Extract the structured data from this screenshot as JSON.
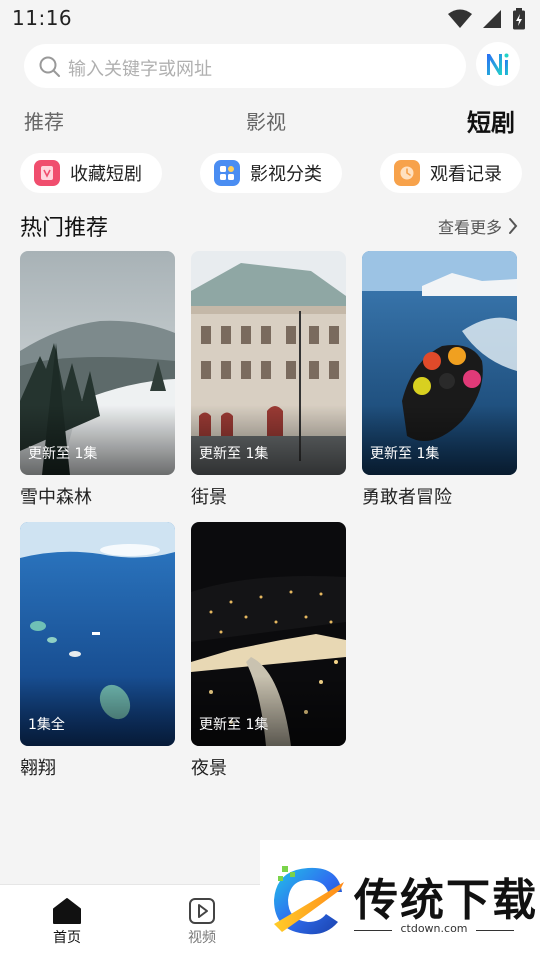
{
  "status_bar": {
    "time": "11:16"
  },
  "search": {
    "placeholder": "输入关键字或网址",
    "ai_icon": "ai-assistant-icon"
  },
  "top_tabs": [
    {
      "label": "推荐"
    },
    {
      "label": "影视"
    },
    {
      "label": "短剧",
      "active": true
    }
  ],
  "chips": [
    {
      "label": "收藏短剧",
      "icon": "favorites-icon",
      "color": "#f04e6e"
    },
    {
      "label": "影视分类",
      "icon": "category-icon",
      "color": "#4a8df2"
    },
    {
      "label": "观看记录",
      "icon": "history-icon",
      "color": "#f7a24b"
    }
  ],
  "section": {
    "title": "热门推荐",
    "more": "查看更多"
  },
  "cards": [
    {
      "title": "雪中森林",
      "badge": "更新至 1集"
    },
    {
      "title": "街景",
      "badge": "更新至 1集"
    },
    {
      "title": "勇敢者冒险",
      "badge": "更新至 1集"
    },
    {
      "title": "翱翔",
      "badge": "1集全"
    },
    {
      "title": "夜景",
      "badge": "更新至 1集"
    }
  ],
  "bottom_nav": [
    {
      "label": "首页",
      "icon": "home-icon",
      "active": true
    },
    {
      "label": "视频",
      "icon": "video-play-icon"
    }
  ],
  "watermark": {
    "brand": "传统下载",
    "url": "ctdown.com"
  },
  "colors": {
    "accent": "#111111",
    "background": "#f4f4f4"
  }
}
